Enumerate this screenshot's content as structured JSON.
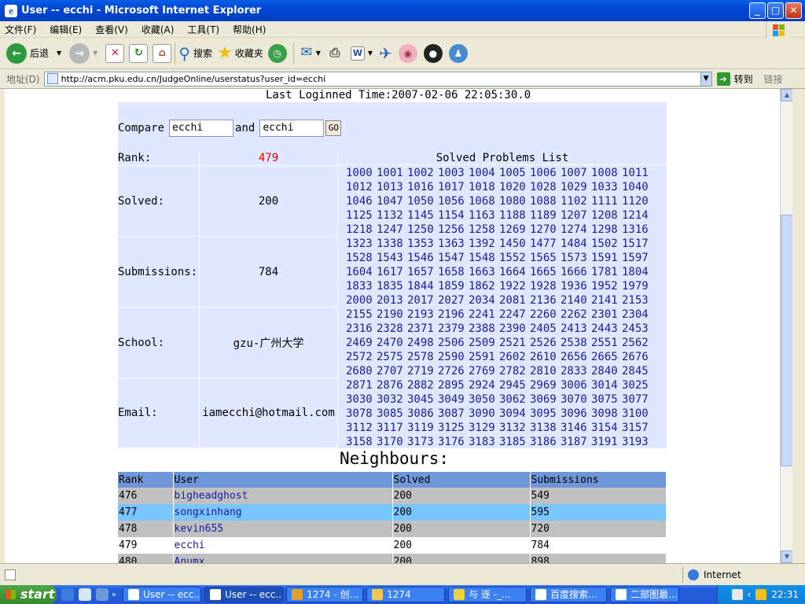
{
  "window": {
    "title": "User -- ecchi - Microsoft Internet Explorer"
  },
  "menu": [
    "文件(F)",
    "编辑(E)",
    "查看(V)",
    "收藏(A)",
    "工具(T)",
    "帮助(H)"
  ],
  "toolbar": {
    "back": "后退",
    "search": "搜索",
    "favorites": "收藏夹"
  },
  "address": {
    "label": "地址(D)",
    "url": "http://acm.pku.edu.cn/JudgeOnline/userstatus?user_id=ecchi",
    "go": "转到",
    "links": "链接"
  },
  "page": {
    "last_login": "Last Loginned Time:2007-02-06 22:05:30.0",
    "compare": {
      "label": "Compare",
      "user1": "ecchi",
      "and": "and",
      "user2": "ecchi",
      "go": "GO"
    },
    "rank_label": "Rank:",
    "rank": "479",
    "solved_label": "Solved:",
    "solved": "200",
    "submissions_label": "Submissions:",
    "submissions": "784",
    "school_label": "School:",
    "school": "gzu-广州大学",
    "email_label": "Email:",
    "email": "iamecchi@hotmail.com",
    "solved_list_title": "Solved Problems List",
    "problems": [
      "1000",
      "1001",
      "1002",
      "1003",
      "1004",
      "1005",
      "1006",
      "1007",
      "1008",
      "1011",
      "1012",
      "1013",
      "1016",
      "1017",
      "1018",
      "1020",
      "1028",
      "1029",
      "1033",
      "1040",
      "1046",
      "1047",
      "1050",
      "1056",
      "1068",
      "1080",
      "1088",
      "1102",
      "1111",
      "1120",
      "1125",
      "1132",
      "1145",
      "1154",
      "1163",
      "1188",
      "1189",
      "1207",
      "1208",
      "1214",
      "1218",
      "1247",
      "1250",
      "1256",
      "1258",
      "1269",
      "1270",
      "1274",
      "1298",
      "1316",
      "1323",
      "1338",
      "1353",
      "1363",
      "1392",
      "1450",
      "1477",
      "1484",
      "1502",
      "1517",
      "1528",
      "1543",
      "1546",
      "1547",
      "1548",
      "1552",
      "1565",
      "1573",
      "1591",
      "1597",
      "1604",
      "1617",
      "1657",
      "1658",
      "1663",
      "1664",
      "1665",
      "1666",
      "1781",
      "1804",
      "1833",
      "1835",
      "1844",
      "1859",
      "1862",
      "1922",
      "1928",
      "1936",
      "1952",
      "1979",
      "2000",
      "2013",
      "2017",
      "2027",
      "2034",
      "2081",
      "2136",
      "2140",
      "2141",
      "2153",
      "2155",
      "2190",
      "2193",
      "2196",
      "2241",
      "2247",
      "2260",
      "2262",
      "2301",
      "2304",
      "2316",
      "2328",
      "2371",
      "2379",
      "2388",
      "2390",
      "2405",
      "2413",
      "2443",
      "2453",
      "2469",
      "2470",
      "2498",
      "2506",
      "2509",
      "2521",
      "2526",
      "2538",
      "2551",
      "2562",
      "2572",
      "2575",
      "2578",
      "2590",
      "2591",
      "2602",
      "2610",
      "2656",
      "2665",
      "2676",
      "2680",
      "2707",
      "2719",
      "2726",
      "2769",
      "2782",
      "2810",
      "2833",
      "2840",
      "2845",
      "2871",
      "2876",
      "2882",
      "2895",
      "2924",
      "2945",
      "2969",
      "3006",
      "3014",
      "3025",
      "3030",
      "3032",
      "3045",
      "3049",
      "3050",
      "3062",
      "3069",
      "3070",
      "3075",
      "3077",
      "3078",
      "3085",
      "3086",
      "3087",
      "3090",
      "3094",
      "3095",
      "3096",
      "3098",
      "3100",
      "3112",
      "3117",
      "3119",
      "3125",
      "3129",
      "3132",
      "3138",
      "3146",
      "3154",
      "3157",
      "3158",
      "3170",
      "3173",
      "3176",
      "3183",
      "3185",
      "3186",
      "3187",
      "3191",
      "3193"
    ],
    "neighbours_title": "Neighbours:",
    "neighbours_headers": [
      "Rank",
      "User",
      "Solved",
      "Submissions"
    ],
    "neighbours": [
      {
        "rank": "476",
        "user": "bigheadghost",
        "solved": "200",
        "submissions": "549",
        "row_color": "#c0c0c0"
      },
      {
        "rank": "477",
        "user": "songxinhang",
        "solved": "200",
        "submissions": "595",
        "row_color": "#79c6ff"
      },
      {
        "rank": "478",
        "user": "kevin655",
        "solved": "200",
        "submissions": "720",
        "row_color": "#c0c0c0"
      },
      {
        "rank": "479",
        "user": "ecchi",
        "solved": "200",
        "submissions": "784",
        "row_color": "#ffffff"
      },
      {
        "rank": "480",
        "user": "Anumx",
        "solved": "200",
        "submissions": "898",
        "row_color": "#c0c0c0"
      }
    ]
  },
  "status": {
    "zone": "Internet"
  },
  "taskbar": {
    "start": "start",
    "tasks": [
      "User -- ecc...",
      "User -- ecc...",
      "1274 - 创...",
      "1274",
      "与 逐 -_...",
      "百度搜索...",
      "二部图最..."
    ],
    "clock": "22:31"
  },
  "colors": {
    "accent": "#0046d5",
    "panel": "#dfe8ff",
    "rank_red": "#e00000",
    "link": "#1a1a9a"
  }
}
